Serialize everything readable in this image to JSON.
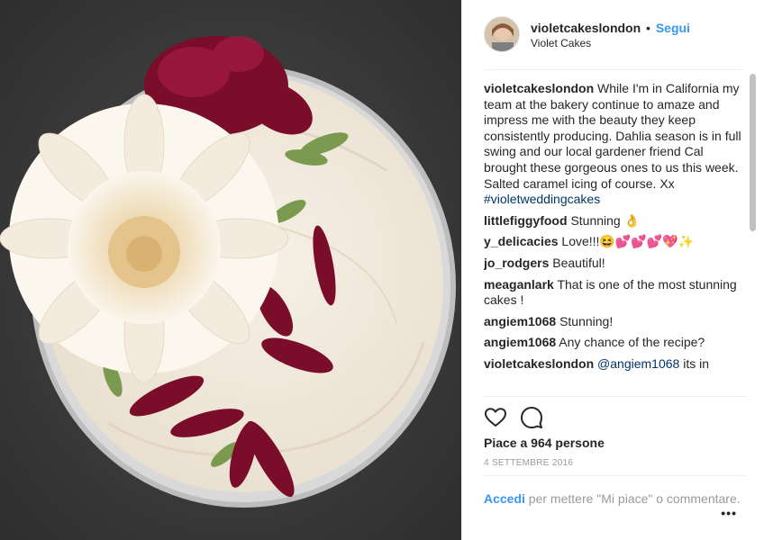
{
  "post": {
    "image_alt": "Cake decorated with white and burgundy dahlias"
  },
  "header": {
    "username": "violetcakeslondon",
    "separator": "•",
    "follow_label": "Segui",
    "location": "Violet Cakes"
  },
  "caption": {
    "username": "violetcakeslondon",
    "text": "While I'm in California my team at the bakery continue to amaze and impress me with the beauty they keep consistently producing. Dahlia season is in full swing and our local gardener friend Cal brought these gorgeous ones to us this week. Salted caramel icing of course. Xx",
    "hashtag": "#violetweddingcakes"
  },
  "comments": [
    {
      "username": "littlefiggyfood",
      "text": "Stunning 👌"
    },
    {
      "username": "y_delicacies",
      "text": "Love!!!😆💕💕💕💖✨"
    },
    {
      "username": "jo_rodgers",
      "text": "Beautiful!"
    },
    {
      "username": "meaganlark",
      "text": "That is one of the most stunning cakes !"
    },
    {
      "username": "angiem1068",
      "text": "Stunning!"
    },
    {
      "username": "angiem1068",
      "text": "Any chance of the recipe?"
    },
    {
      "username": "violetcakeslondon",
      "mention": "@angiem1068",
      "text": " its in"
    }
  ],
  "actions": {
    "like_icon": "heart-icon",
    "comment_icon": "comment-icon"
  },
  "likes_text": "Piace a 964 persone",
  "date_text": "4 settembre 2016",
  "login": {
    "link": "Accedi",
    "text": " per mettere \"Mi piace\" o commentare."
  },
  "more_label": "•••",
  "colors": {
    "link_blue": "#3897f0",
    "hashtag_blue": "#003569",
    "text": "#262626",
    "muted": "#999999"
  }
}
